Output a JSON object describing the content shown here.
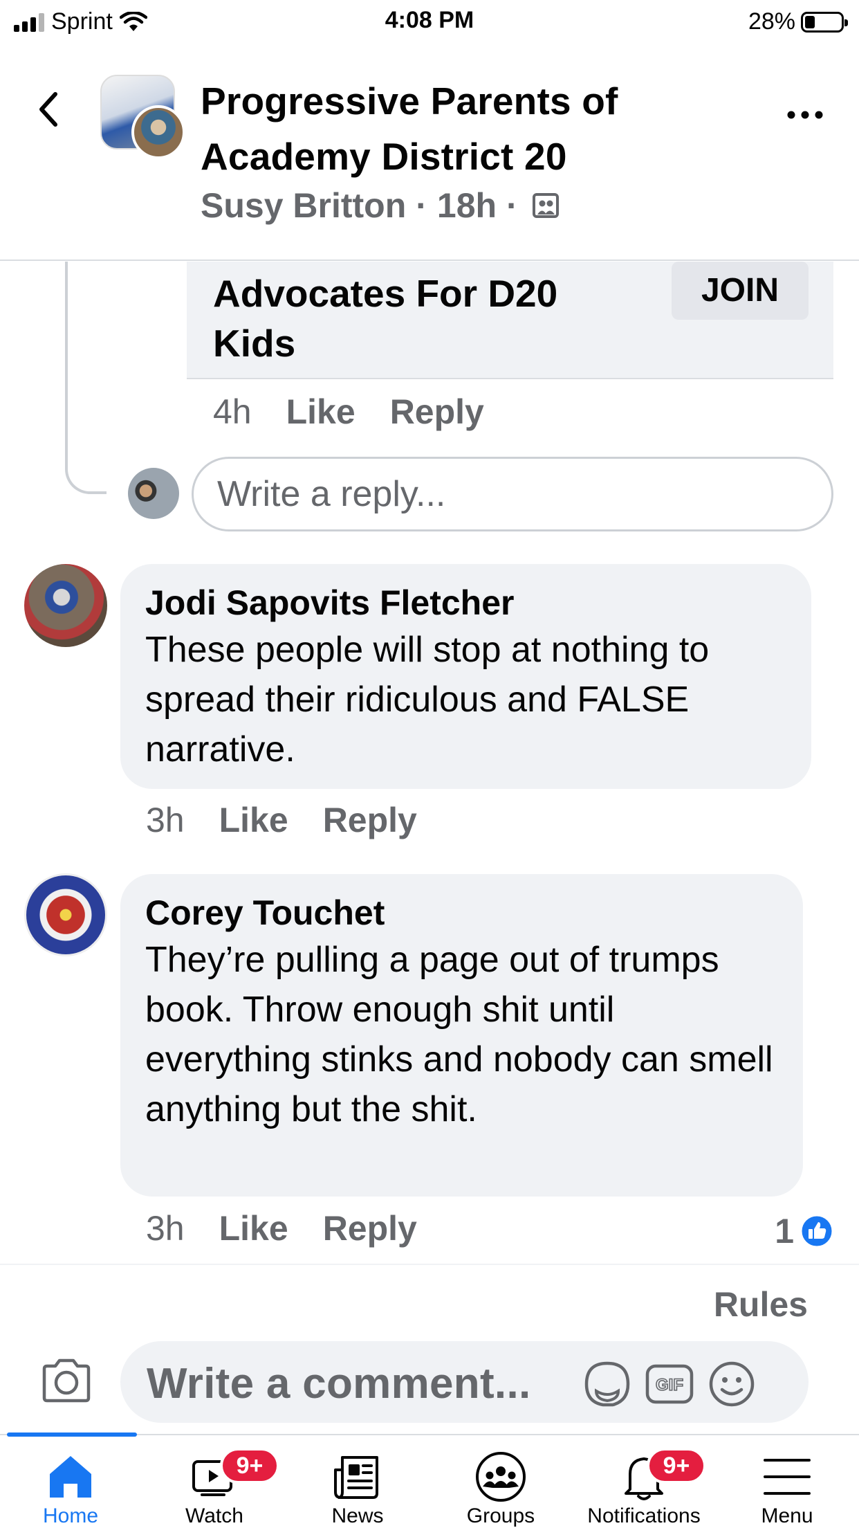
{
  "status_bar": {
    "carrier": "Sprint",
    "time": "4:08 PM",
    "battery": "28%",
    "battery_level": 0.28
  },
  "header": {
    "title": "Progressive Parents of Academy District 20",
    "author": "Susy Britton",
    "separator": "·",
    "age": "18h"
  },
  "group_card": {
    "title": "Advocates For D20 Kids",
    "join_label": "JOIN"
  },
  "reply_actions": {
    "time": "4h",
    "like": "Like",
    "reply": "Reply"
  },
  "reply_input": {
    "placeholder": "Write a reply..."
  },
  "comments": [
    {
      "author": "Jodi Sapovits Fletcher",
      "text": "These people will stop at nothing to spread their ridiculous and FALSE narrative.",
      "time": "3h",
      "like": "Like",
      "reply": "Reply"
    },
    {
      "author": "Corey Touchet",
      "text": "They’re pulling a page out of trumps book. Throw enough shit until everything stinks and nobody can smell anything but the shit.",
      "time": "3h",
      "like": "Like",
      "reply": "Reply",
      "reaction_count": "1"
    }
  ],
  "composer": {
    "rules": "Rules",
    "placeholder": "Write a comment..."
  },
  "tabbar": {
    "tabs": [
      {
        "label": "Home",
        "icon": "home-icon"
      },
      {
        "label": "Watch",
        "icon": "watch-icon",
        "badge": "9+"
      },
      {
        "label": "News",
        "icon": "news-icon"
      },
      {
        "label": "Groups",
        "icon": "groups-icon"
      },
      {
        "label": "Notifications",
        "icon": "bell-icon",
        "badge": "9+"
      },
      {
        "label": "Menu",
        "icon": "menu-icon"
      }
    ],
    "active": "Home"
  },
  "colors": {
    "accent": "#1877f2",
    "badge": "#e41e3f",
    "bubble": "#f0f2f5",
    "secondary_text": "#65676b"
  }
}
